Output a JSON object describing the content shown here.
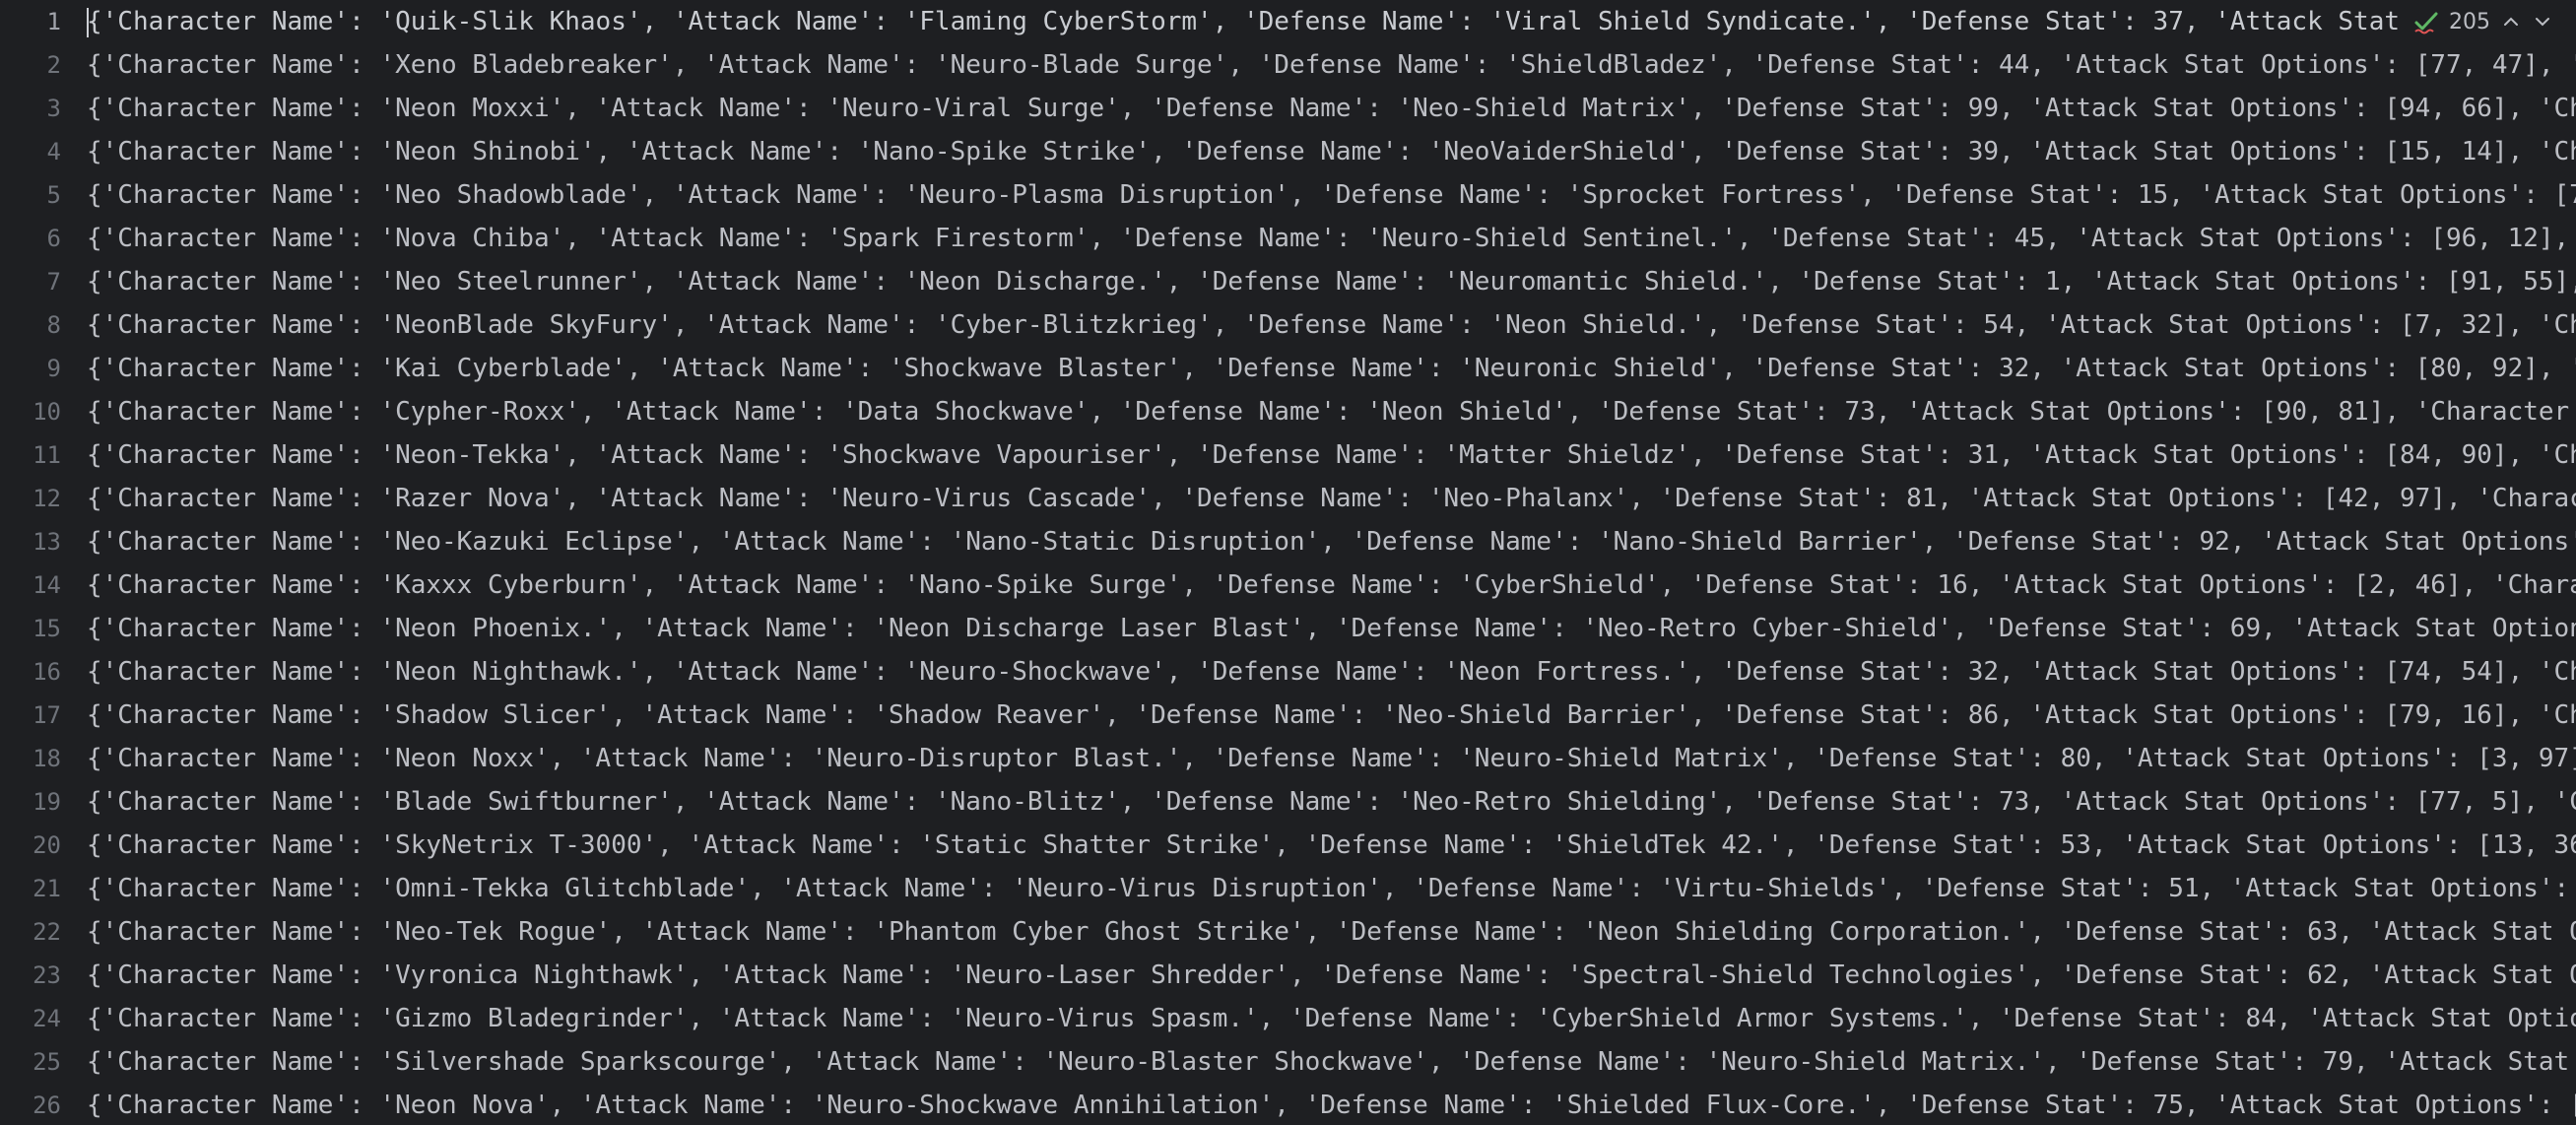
{
  "inspection": {
    "count": "205"
  },
  "lines": [
    {
      "num": "1",
      "text": "{'Character Name': 'Quik-Slik Khaos', 'Attack Name': 'Flaming CyberStorm', 'Defense Name': 'Viral Shield Syndicate.', 'Defense Stat': 37, 'Attack Stat"
    },
    {
      "num": "2",
      "text": "{'Character Name': 'Xeno Bladebreaker', 'Attack Name': 'Neuro-Blade Surge', 'Defense Name': 'ShieldBladez', 'Defense Stat': 44, 'Attack Stat Options': [77, 47], 'Ch"
    },
    {
      "num": "3",
      "text": "{'Character Name': 'Neon Moxxi', 'Attack Name': 'Neuro-Viral Surge', 'Defense Name': 'Neo-Shield Matrix', 'Defense Stat': 99, 'Attack Stat Options': [94, 66], 'Ch"
    },
    {
      "num": "4",
      "text": "{'Character Name': 'Neon Shinobi', 'Attack Name': 'Nano-Spike Strike', 'Defense Name': 'NeoVaiderShield', 'Defense Stat': 39, 'Attack Stat Options': [15, 14], 'Ch"
    },
    {
      "num": "5",
      "text": "{'Character Name': 'Neo Shadowblade', 'Attack Name': 'Neuro-Plasma Disruption', 'Defense Name': 'Sprocket Fortress', 'Defense Stat': 15, 'Attack Stat Options': [7"
    },
    {
      "num": "6",
      "text": "{'Character Name': 'Nova Chiba', 'Attack Name': 'Spark Firestorm', 'Defense Name': 'Neuro-Shield Sentinel.', 'Defense Stat': 45, 'Attack Stat Options': [96, 12], "
    },
    {
      "num": "7",
      "text": "{'Character Name': 'Neo Steelrunner', 'Attack Name': 'Neon Discharge.', 'Defense Name': 'Neuromantic Shield.', 'Defense Stat': 1, 'Attack Stat Options': [91, 55], "
    },
    {
      "num": "8",
      "text": "{'Character Name': 'NeonBlade SkyFury', 'Attack Name': 'Cyber-Blitzkrieg', 'Defense Name': 'Neon Shield.', 'Defense Stat': 54, 'Attack Stat Options': [7, 32], 'Ch"
    },
    {
      "num": "9",
      "text": "{'Character Name': 'Kai Cyberblade', 'Attack Name': 'Shockwave Blaster', 'Defense Name': 'Neuronic Shield', 'Defense Stat': 32, 'Attack Stat Options': [80, 92], '"
    },
    {
      "num": "10",
      "text": "{'Character Name': 'Cypher-Roxx', 'Attack Name': 'Data Shockwave', 'Defense Name': 'Neon Shield', 'Defense Stat': 73, 'Attack Stat Options': [90, 81], 'Character "
    },
    {
      "num": "11",
      "text": "{'Character Name': 'Neon-Tekka', 'Attack Name': 'Shockwave Vapouriser', 'Defense Name': 'Matter Shieldz', 'Defense Stat': 31, 'Attack Stat Options': [84, 90], 'Ch"
    },
    {
      "num": "12",
      "text": "{'Character Name': 'Razer Nova', 'Attack Name': 'Neuro-Virus Cascade', 'Defense Name': 'Neo-Phalanx', 'Defense Stat': 81, 'Attack Stat Options': [42, 97], 'Charac"
    },
    {
      "num": "13",
      "text": "{'Character Name': 'Neo-Kazuki Eclipse', 'Attack Name': 'Nano-Static Disruption', 'Defense Name': 'Nano-Shield Barrier', 'Defense Stat': 92, 'Attack Stat Options'"
    },
    {
      "num": "14",
      "text": "{'Character Name': 'Kaxxx Cyberburn', 'Attack Name': 'Nano-Spike Surge', 'Defense Name': 'CyberShield', 'Defense Stat': 16, 'Attack Stat Options': [2, 46], 'Chara"
    },
    {
      "num": "15",
      "text": "{'Character Name': 'Neon Phoenix.', 'Attack Name': 'Neon Discharge Laser Blast', 'Defense Name': 'Neo-Retro Cyber-Shield', 'Defense Stat': 69, 'Attack Stat Option"
    },
    {
      "num": "16",
      "text": "{'Character Name': 'Neon Nighthawk.', 'Attack Name': 'Neuro-Shockwave', 'Defense Name': 'Neon Fortress.', 'Defense Stat': 32, 'Attack Stat Options': [74, 54], 'Ch"
    },
    {
      "num": "17",
      "text": "{'Character Name': 'Shadow Slicer', 'Attack Name': 'Shadow Reaver', 'Defense Name': 'Neo-Shield Barrier', 'Defense Stat': 86, 'Attack Stat Options': [79, 16], 'Ch"
    },
    {
      "num": "18",
      "text": "{'Character Name': 'Neon Noxx', 'Attack Name': 'Neuro-Disruptor Blast.', 'Defense Name': 'Neuro-Shield Matrix', 'Defense Stat': 80, 'Attack Stat Options': [3, 97]"
    },
    {
      "num": "19",
      "text": "{'Character Name': 'Blade Swiftburner', 'Attack Name': 'Nano-Blitz', 'Defense Name': 'Neo-Retro Shielding', 'Defense Stat': 73, 'Attack Stat Options': [77, 5], 'C"
    },
    {
      "num": "20",
      "text": "{'Character Name': 'SkyNetrix T-3000', 'Attack Name': 'Static Shatter Strike', 'Defense Name': 'ShieldTek 42.', 'Defense Stat': 53, 'Attack Stat Options': [13, 36"
    },
    {
      "num": "21",
      "text": "{'Character Name': 'Omni-Tekka Glitchblade', 'Attack Name': 'Neuro-Virus Disruption', 'Defense Name': 'Virtu-Shields', 'Defense Stat': 51, 'Attack Stat Options': "
    },
    {
      "num": "22",
      "text": "{'Character Name': 'Neo-Tek Rogue', 'Attack Name': 'Phantom Cyber Ghost Strike', 'Defense Name': 'Neon Shielding Corporation.', 'Defense Stat': 63, 'Attack Stat O"
    },
    {
      "num": "23",
      "text": "{'Character Name': 'Vyronica Nighthawk', 'Attack Name': 'Neuro-Laser Shredder', 'Defense Name': 'Spectral-Shield Technologies', 'Defense Stat': 62, 'Attack Stat O"
    },
    {
      "num": "24",
      "text": "{'Character Name': 'Gizmo Bladegrinder', 'Attack Name': 'Neuro-Virus Spasm.', 'Defense Name': 'CyberShield Armor Systems.', 'Defense Stat': 84, 'Attack Stat Optio"
    },
    {
      "num": "25",
      "text": "{'Character Name': 'Silvershade Sparkscourge', 'Attack Name': 'Neuro-Blaster Shockwave', 'Defense Name': 'Neuro-Shield Matrix.', 'Defense Stat': 79, 'Attack Stat "
    },
    {
      "num": "26",
      "text": "{'Character Name': 'Neon Nova', 'Attack Name': 'Neuro-Shockwave Annihilation', 'Defense Name': 'Shielded Flux-Core.', 'Defense Stat': 75, 'Attack Stat Options': ["
    }
  ]
}
